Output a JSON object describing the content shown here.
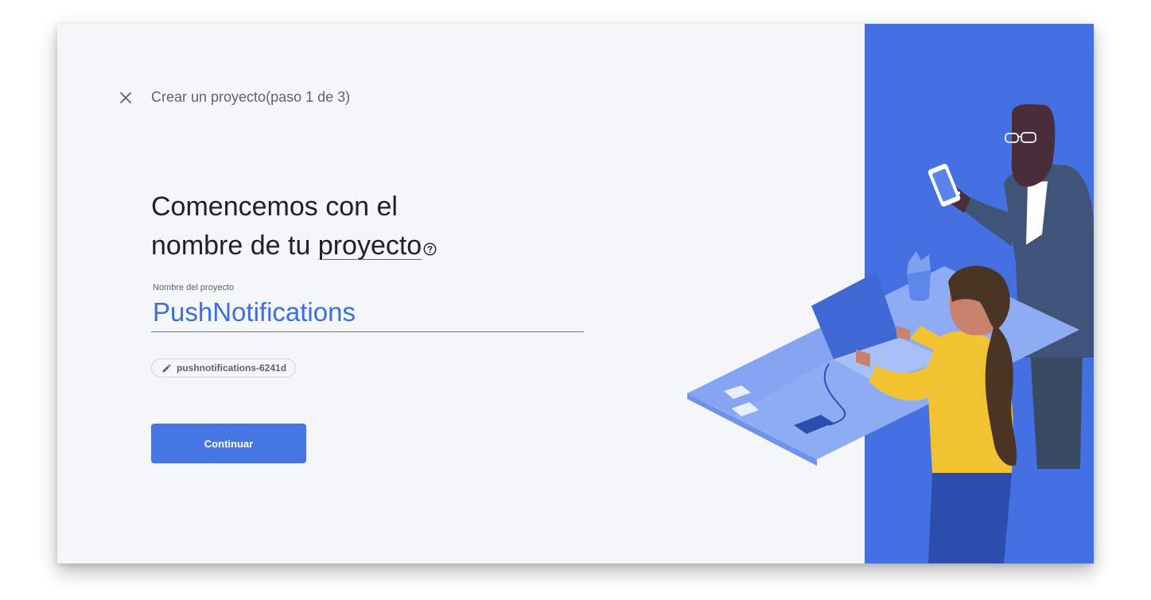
{
  "header": {
    "close_icon": "close-icon",
    "step_title": "Crear un proyecto(paso 1 de 3)"
  },
  "headline": {
    "line1": "Comencemos con el",
    "line2_prefix": "nombre de tu ",
    "line2_link": "proyecto",
    "help_icon": "help-circle-icon"
  },
  "project_field": {
    "label": "Nombre del proyecto",
    "value": "PushNotifications"
  },
  "project_id_chip": {
    "icon": "pencil-icon",
    "text": "pushnotifications-6241d"
  },
  "actions": {
    "continue_label": "Continuar"
  },
  "colors": {
    "accent": "#4676e3",
    "panel_blue": "#4470e2",
    "background": "#f5f6f8",
    "text_primary": "#202124",
    "text_secondary": "#5f6368"
  }
}
